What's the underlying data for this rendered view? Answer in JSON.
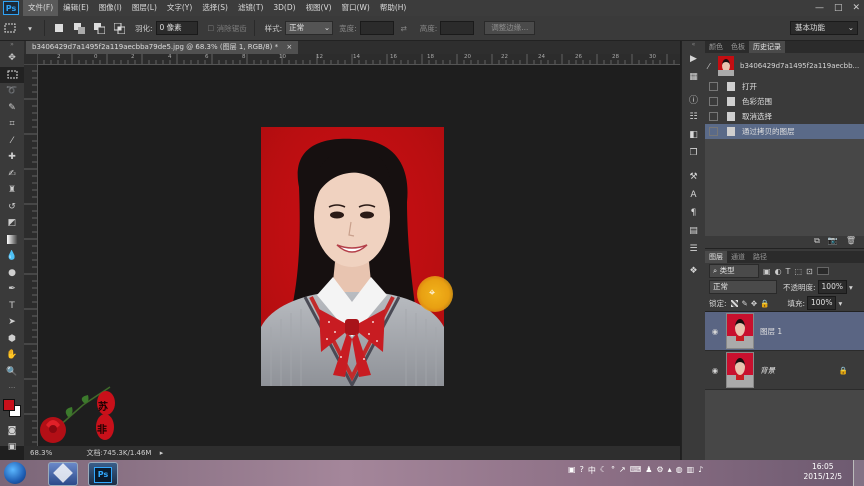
{
  "menubar": {
    "logo": "Ps",
    "items": [
      "文件(F)",
      "编辑(E)",
      "图像(I)",
      "图层(L)",
      "文字(Y)",
      "选择(S)",
      "滤镜(T)",
      "3D(D)",
      "视图(V)",
      "窗口(W)",
      "帮助(H)"
    ],
    "window_controls": [
      "—",
      "□",
      "✕"
    ]
  },
  "options": {
    "feather_label": "羽化:",
    "feather_value": "0 像素",
    "antialias_label": "消除锯齿",
    "style_label": "样式:",
    "style_value": "正常",
    "width_label": "宽度:",
    "height_label": "高度:",
    "refine_edge": "调整边缘...",
    "workspace": "基本功能"
  },
  "document": {
    "tab_title": "b3406429d7a1495f2a119aecbba79de5.jpg @ 68.3% (图层 1, RGB/8) *",
    "close": "×",
    "ruler_numbers": [
      "2",
      "0",
      "2",
      "4",
      "6",
      "8",
      "10",
      "12",
      "14",
      "16",
      "18",
      "20",
      "22",
      "24",
      "26",
      "28",
      "30"
    ],
    "zoom": "68.3%",
    "doc_info": "文档:745.3K/1.46M"
  },
  "history_panel": {
    "tabs": [
      "颜色",
      "色板",
      "历史记录"
    ],
    "snapshot_label": "b3406429d7a1495f2a119aecbb...",
    "steps": [
      "打开",
      "色彩范围",
      "取消选择",
      "通过拷贝的图层"
    ]
  },
  "layers_panel": {
    "tabs": [
      "图层",
      "通道",
      "路径"
    ],
    "filter_kind": "类型",
    "blend_mode": "正常",
    "opacity_label": "不透明度:",
    "opacity_value": "100%",
    "lock_label": "锁定:",
    "fill_label": "填充:",
    "fill_value": "100%",
    "layers": [
      {
        "name": "图层 1",
        "selected": true
      },
      {
        "name": "背景",
        "selected": false,
        "locked": true
      }
    ]
  },
  "watermark": [
    "苏",
    "非"
  ],
  "taskbar": {
    "time": "16:05",
    "date": "2015/12/5",
    "ps_label": "Ps"
  },
  "colors": {
    "foreground": "#c8101a",
    "background": "#ffffff",
    "photo_bg": "#c40e12",
    "accent_selection": "#5a6a88"
  }
}
